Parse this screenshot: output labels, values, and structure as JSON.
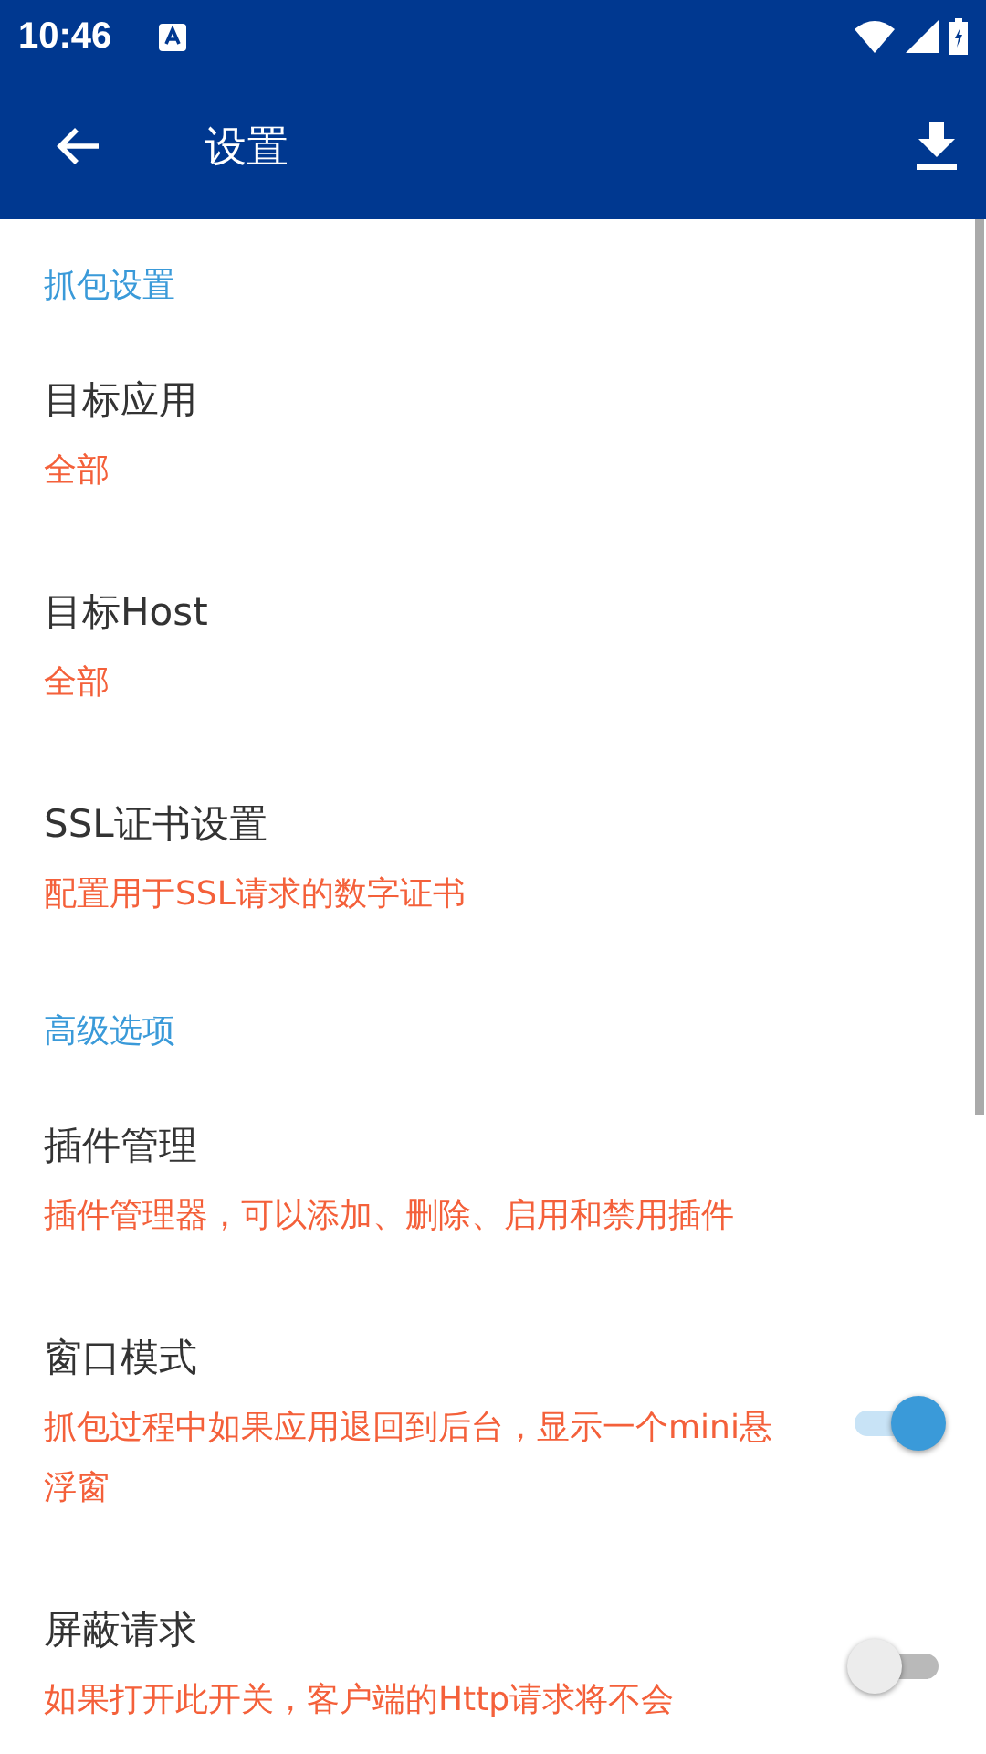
{
  "status_bar": {
    "time": "10:46"
  },
  "app_bar": {
    "title": "设置"
  },
  "sections": [
    {
      "header": "抓包设置",
      "items": [
        {
          "kind": "text",
          "title": "目标应用",
          "summary": "全部"
        },
        {
          "kind": "text",
          "title": "目标Host",
          "summary": "全部"
        },
        {
          "kind": "text",
          "title": "SSL证书设置",
          "summary": "配置用于SSL请求的数字证书"
        }
      ]
    },
    {
      "header": "高级选项",
      "items": [
        {
          "kind": "text",
          "title": "插件管理",
          "summary": "插件管理器，可以添加、删除、启用和禁用插件"
        },
        {
          "kind": "switch",
          "title": "窗口模式",
          "summary": "抓包过程中如果应用退回到后台，显示一个mini悬浮窗",
          "on": true
        },
        {
          "kind": "switch",
          "title": "屏蔽请求",
          "summary": "如果打开此开关，客户端的Http请求将不会",
          "on": false
        }
      ]
    }
  ]
}
